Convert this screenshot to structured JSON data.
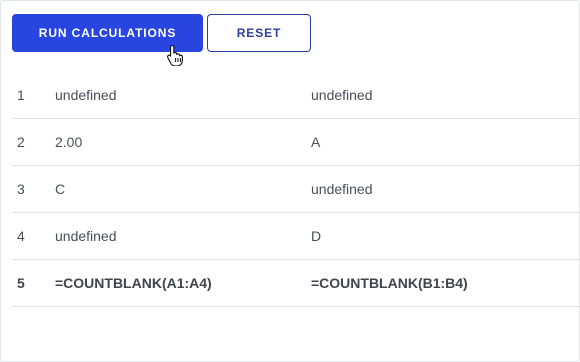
{
  "toolbar": {
    "run_label": "RUN CALCULATIONS",
    "reset_label": "RESET"
  },
  "colors": {
    "primary_button": "#2845e0",
    "secondary_button_border": "#2a3f9e",
    "row_divider": "#dfe2e6",
    "text": "#4a4f57"
  },
  "cursor": {
    "icon": "hand-pointer-icon"
  },
  "rows": [
    {
      "index": "1",
      "a": "undefined",
      "b": "undefined"
    },
    {
      "index": "2",
      "a": "2.00",
      "b": "A"
    },
    {
      "index": "3",
      "a": "C",
      "b": "undefined"
    },
    {
      "index": "4",
      "a": "undefined",
      "b": "D"
    },
    {
      "index": "5",
      "a": "=COUNTBLANK(A1:A4)",
      "b": "=COUNTBLANK(B1:B4)"
    }
  ]
}
